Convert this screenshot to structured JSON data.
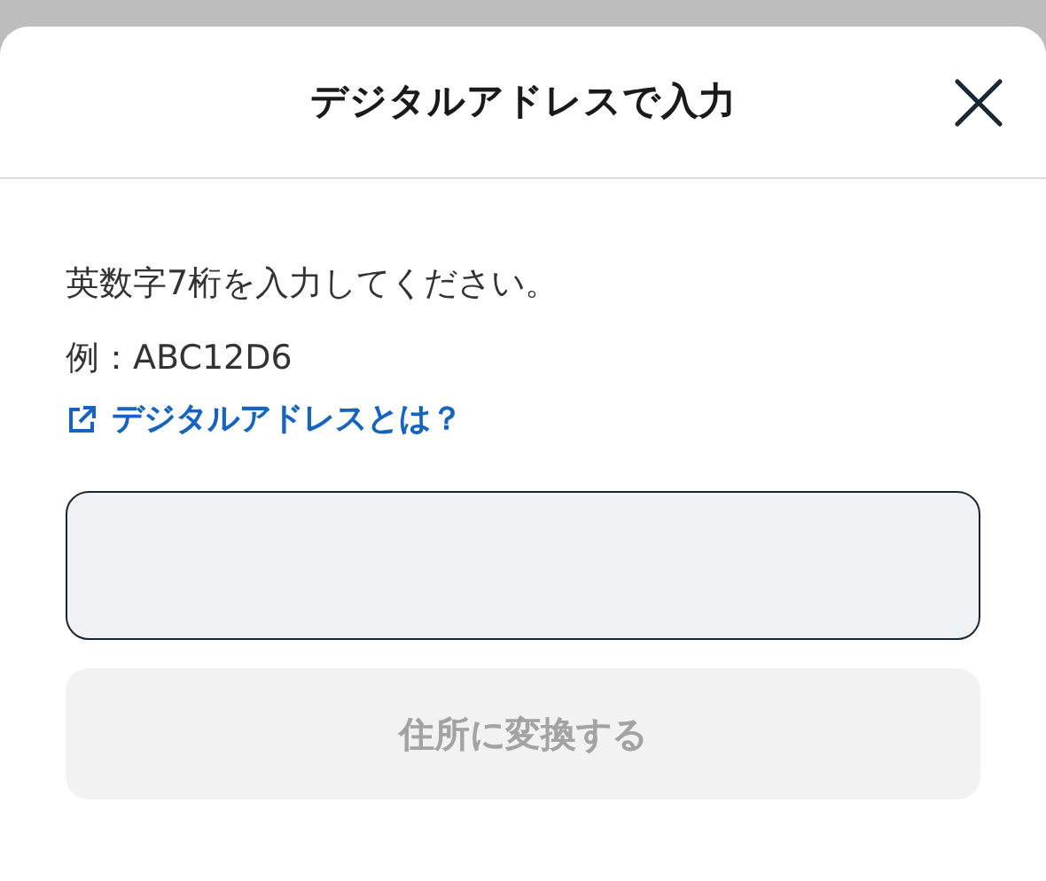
{
  "dialog": {
    "title": "デジタルアドレスで入力"
  },
  "instruction": "英数字7桁を入力してください。",
  "example": "例：ABC12D6",
  "help_link": {
    "label": "デジタルアドレスとは？"
  },
  "address_field": {
    "focused": true
  },
  "submit_button": {
    "label": "住所に変換する",
    "disabled": true
  }
}
